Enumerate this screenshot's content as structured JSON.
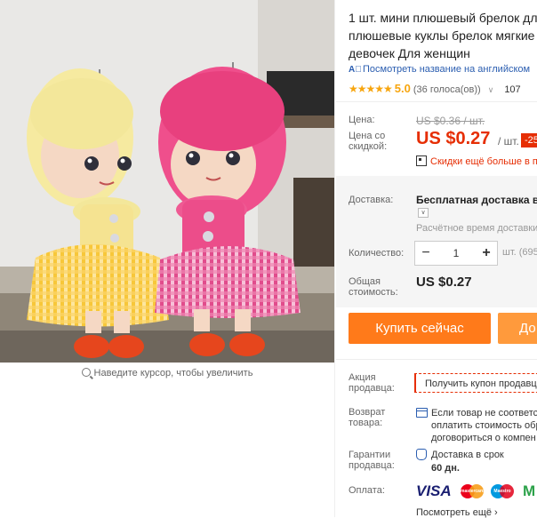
{
  "title_lines": [
    "1 шт. мини плюшевый брелок для",
    "плюшевые куклы брелок мягкие б",
    "девочек Для женщин"
  ],
  "translate_link": "Посмотреть название на английском",
  "rating": {
    "stars": "★★★★★",
    "score": "5.0",
    "votes": "(36 голоса(ов))",
    "orders": "107"
  },
  "zoom_hint": "Наведите курсор, чтобы увеличить",
  "price_label": "Цена:",
  "original_price": "US $0.36 / шт.",
  "discount_label": "Цена со скидкой:",
  "price": "US $0.27",
  "price_unit": "/ шт.",
  "discount_badge": "-25",
  "app_discount": "Скидки ещё больше в п",
  "shipping_label": "Доставка:",
  "shipping_title": "Бесплатная доставка в Ru",
  "shipping_time": "Расчётное время доставки",
  "quantity_label": "Количество:",
  "quantity_value": "1",
  "quantity_unit": "шт. (695",
  "total_label": "Общая стоимость:",
  "total_value": "US $0.27",
  "buy_now": "Купить сейчас",
  "add_to_cart": "До",
  "promo_label": "Акция продавца:",
  "coupon": "Получить купон продавц",
  "return_label": "Возврат товара:",
  "return_lines": [
    "Если товар не соответст",
    "оплатить стоимость обр",
    "договориться о компен"
  ],
  "guarantee_label": "Гарантии продавца:",
  "guarantee_lines": [
    "Доставка в срок",
    "60 дн."
  ],
  "payment_label": "Оплата:",
  "payment": {
    "visa": "VISA",
    "mc": "mastercard",
    "maestro": "Maestro",
    "mir": "М"
  },
  "more_link": "Посмотреть ещё ›",
  "colors": {
    "accent": "#e62e04",
    "buy": "#ff7a1a",
    "link": "#2a5db0",
    "star": "#f7a50e"
  }
}
